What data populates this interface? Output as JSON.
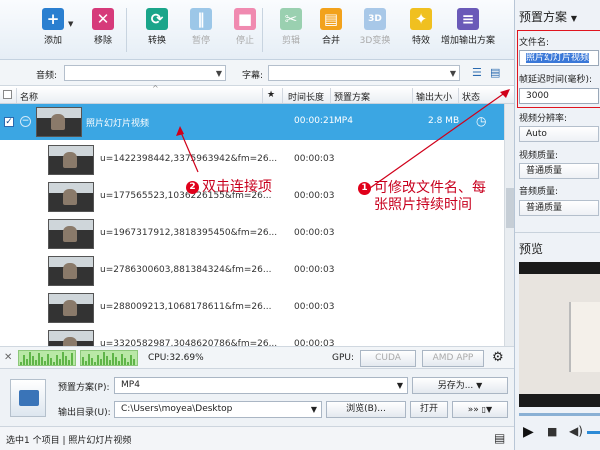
{
  "toolbar": {
    "items": [
      {
        "label": "添加",
        "icon": "add-icon",
        "color": "#2a7fd0",
        "glyph": "+",
        "enabled": true
      },
      {
        "label": "移除",
        "icon": "remove-icon",
        "color": "#d63a7a",
        "glyph": "✕",
        "enabled": true
      },
      {
        "label": "转换",
        "icon": "convert-icon",
        "color": "#1aa58a",
        "glyph": "⟳",
        "enabled": true
      },
      {
        "label": "暂停",
        "icon": "pause-icon",
        "color": "#9cc7e8",
        "glyph": "‖",
        "enabled": false
      },
      {
        "label": "停止",
        "icon": "stop-icon",
        "color": "#f08ab0",
        "glyph": "■",
        "enabled": false
      },
      {
        "label": "剪辑",
        "icon": "scissors-icon",
        "color": "#9ad0b0",
        "glyph": "✂",
        "enabled": false
      },
      {
        "label": "合并",
        "icon": "merge-icon",
        "color": "#f2a21c",
        "glyph": "▤",
        "enabled": true
      },
      {
        "label": "3D变换",
        "icon": "3d-icon",
        "color": "#a8c8e8",
        "glyph": "3D",
        "enabled": false
      },
      {
        "label": "特效",
        "icon": "magic-wand-icon",
        "color": "#f0c020",
        "glyph": "✦",
        "enabled": true
      },
      {
        "label": "增加输出方案",
        "icon": "add-profile-icon",
        "color": "#6a5ab8",
        "glyph": "≡",
        "enabled": true
      }
    ]
  },
  "filter": {
    "audio_label": "音频:",
    "subtitle_label": "字幕:"
  },
  "columns": {
    "name": "名称",
    "star": "★",
    "duration": "时间长度",
    "profile": "预置方案",
    "size": "输出大小",
    "status": "状态"
  },
  "selected_item": {
    "name": "照片幻灯片视频",
    "duration": "00:00:21",
    "profile": "MP4",
    "size": "2.8 MB"
  },
  "child_items": [
    {
      "name": "u=1422398442,3375963942&fm=26...",
      "duration": "00:00:03"
    },
    {
      "name": "u=177565523,1036226155&fm=26...",
      "duration": "00:00:03"
    },
    {
      "name": "u=1967317912,3818395450&fm=26...",
      "duration": "00:00:03"
    },
    {
      "name": "u=2786300603,881384324&fm=26...",
      "duration": "00:00:03"
    },
    {
      "name": "u=288009213,1068178611&fm=26...",
      "duration": "00:00:03"
    },
    {
      "name": "u=3320582987,3048620786&fm=26...",
      "duration": "00:00:03"
    }
  ],
  "annotations": {
    "one_num": "1",
    "one_line1": "可修改文件名、每",
    "one_line2": "张照片持续时间",
    "two_num": "2",
    "two_text": "双击连接项"
  },
  "cpu": {
    "label": "CPU:32.69%",
    "gpu_label": "GPU:",
    "cuda": "CUDA",
    "amd": "AMD APP"
  },
  "bottom": {
    "profile_label": "预置方案(P):",
    "profile_value": "MP4",
    "save_as": "另存为...",
    "output_label": "输出目录(U):",
    "output_value": "C:\\Users\\moyea\\Desktop",
    "browse": "浏览(B)...",
    "open": "打开",
    "more": "»»"
  },
  "status": {
    "text": "选中1 个项目 | 照片幻灯片视频"
  },
  "right_panel": {
    "title": "预置方案",
    "filename_label": "文件名:",
    "filename_value": "照片幻灯片视频",
    "delay_label": "帧延迟时间(毫秒):",
    "delay_value": "3000",
    "resolution_label": "视频分辨率:",
    "resolution_value": "Auto",
    "vquality_label": "视频质量:",
    "vquality_value": "普通质量",
    "aquality_label": "音频质量:",
    "aquality_value": "普通质量",
    "preview_label": "预览"
  }
}
